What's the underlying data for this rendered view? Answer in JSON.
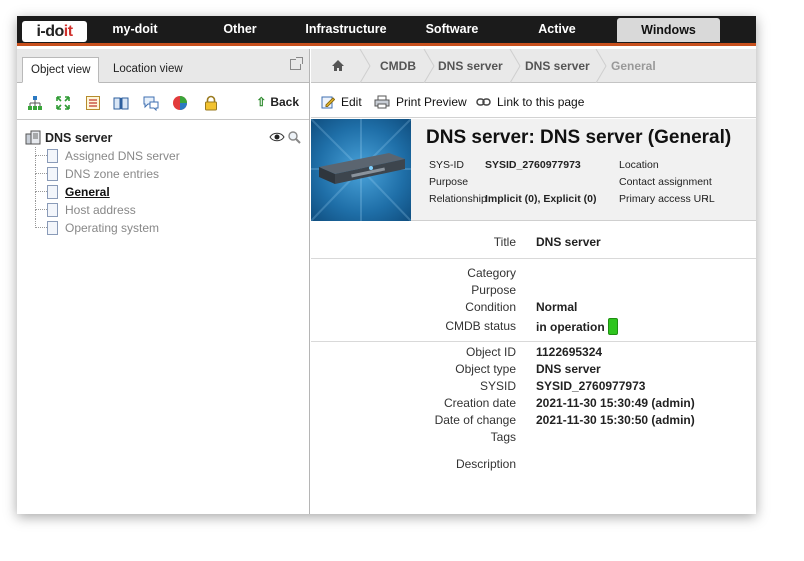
{
  "logo": {
    "part1": "i-do",
    "part2": "it"
  },
  "nav": [
    "my-doit",
    "Other",
    "Infrastructure",
    "Software",
    "Active directory",
    "Windows systems"
  ],
  "left": {
    "tabs": [
      "Object view",
      "Location view"
    ],
    "back_label": "Back",
    "tree_root": "DNS server",
    "tree_items": [
      "Assigned DNS server",
      "DNS zone entries",
      "General",
      "Host address",
      "Operating system"
    ],
    "selected_item": "General"
  },
  "breadcrumb": [
    "CMDB",
    "DNS server",
    "DNS server",
    "General"
  ],
  "actions": {
    "edit": "Edit",
    "print": "Print Preview",
    "link": "Link to this page"
  },
  "object": {
    "title": "DNS server: DNS server (General)",
    "sysid_label": "SYS-ID",
    "sysid": "SYSID_2760977973",
    "purpose_label": "Purpose",
    "relationship_label": "Relationship",
    "relationship": "Implicit (0), Explicit (0)",
    "location_label": "Location",
    "contact_label": "Contact assignment",
    "url_label": "Primary access URL",
    "url_value": "-"
  },
  "fields": {
    "title_label": "Title",
    "title_value": "DNS server",
    "category_label": "Category",
    "purpose_label": "Purpose",
    "condition_label": "Condition",
    "condition_value": "Normal",
    "cmdb_label": "CMDB status",
    "cmdb_value": "in operation",
    "objid_label": "Object ID",
    "objid_value": "1122695324",
    "objtype_label": "Object type",
    "objtype_value": "DNS server",
    "sysid_label": "SYSID",
    "sysid_value": "SYSID_2760977973",
    "created_label": "Creation date",
    "created_value": "2021-11-30 15:30:49 (admin)",
    "changed_label": "Date of change",
    "changed_value": "2021-11-30 15:30:50 (admin)",
    "tags_label": "Tags",
    "desc_label": "Description"
  },
  "colors": {
    "topbar": "#1b1b1b",
    "accent": "#c8501d",
    "status_green": "#2ec51e"
  }
}
